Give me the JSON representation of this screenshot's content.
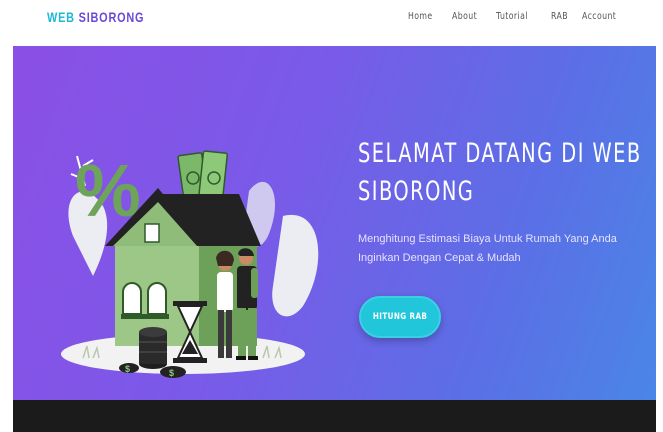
{
  "header": {
    "brand_part1": "WEB",
    "brand_part2": "SIBORONG",
    "nav": [
      "Home",
      "About",
      "Tutorial",
      "RAB",
      "Account"
    ]
  },
  "hero": {
    "title_line1": "SELAMAT DATANG DI WEB",
    "title_line2": "SIBORONG",
    "subtitle_line1": "Menghitung Estimasi Biaya Untuk Rumah Yang Anda",
    "subtitle_line2": "Inginkan Dengan Cepat & Mudah",
    "cta_label": "HITUNG RAB",
    "illustration_text": {
      "percent_sign": "%",
      "dollar_sign": "$"
    }
  },
  "colors": {
    "accent_cyan": "#22c6da",
    "brand_purple": "#6b48d8",
    "gradient_start": "#8b4fe6",
    "gradient_end": "#4a86e6",
    "footer": "#1b1b1b"
  },
  "icons": [
    "percent-icon",
    "money-icon",
    "house-icon",
    "hourglass-icon",
    "coin-stack-icon",
    "couple-icon"
  ]
}
